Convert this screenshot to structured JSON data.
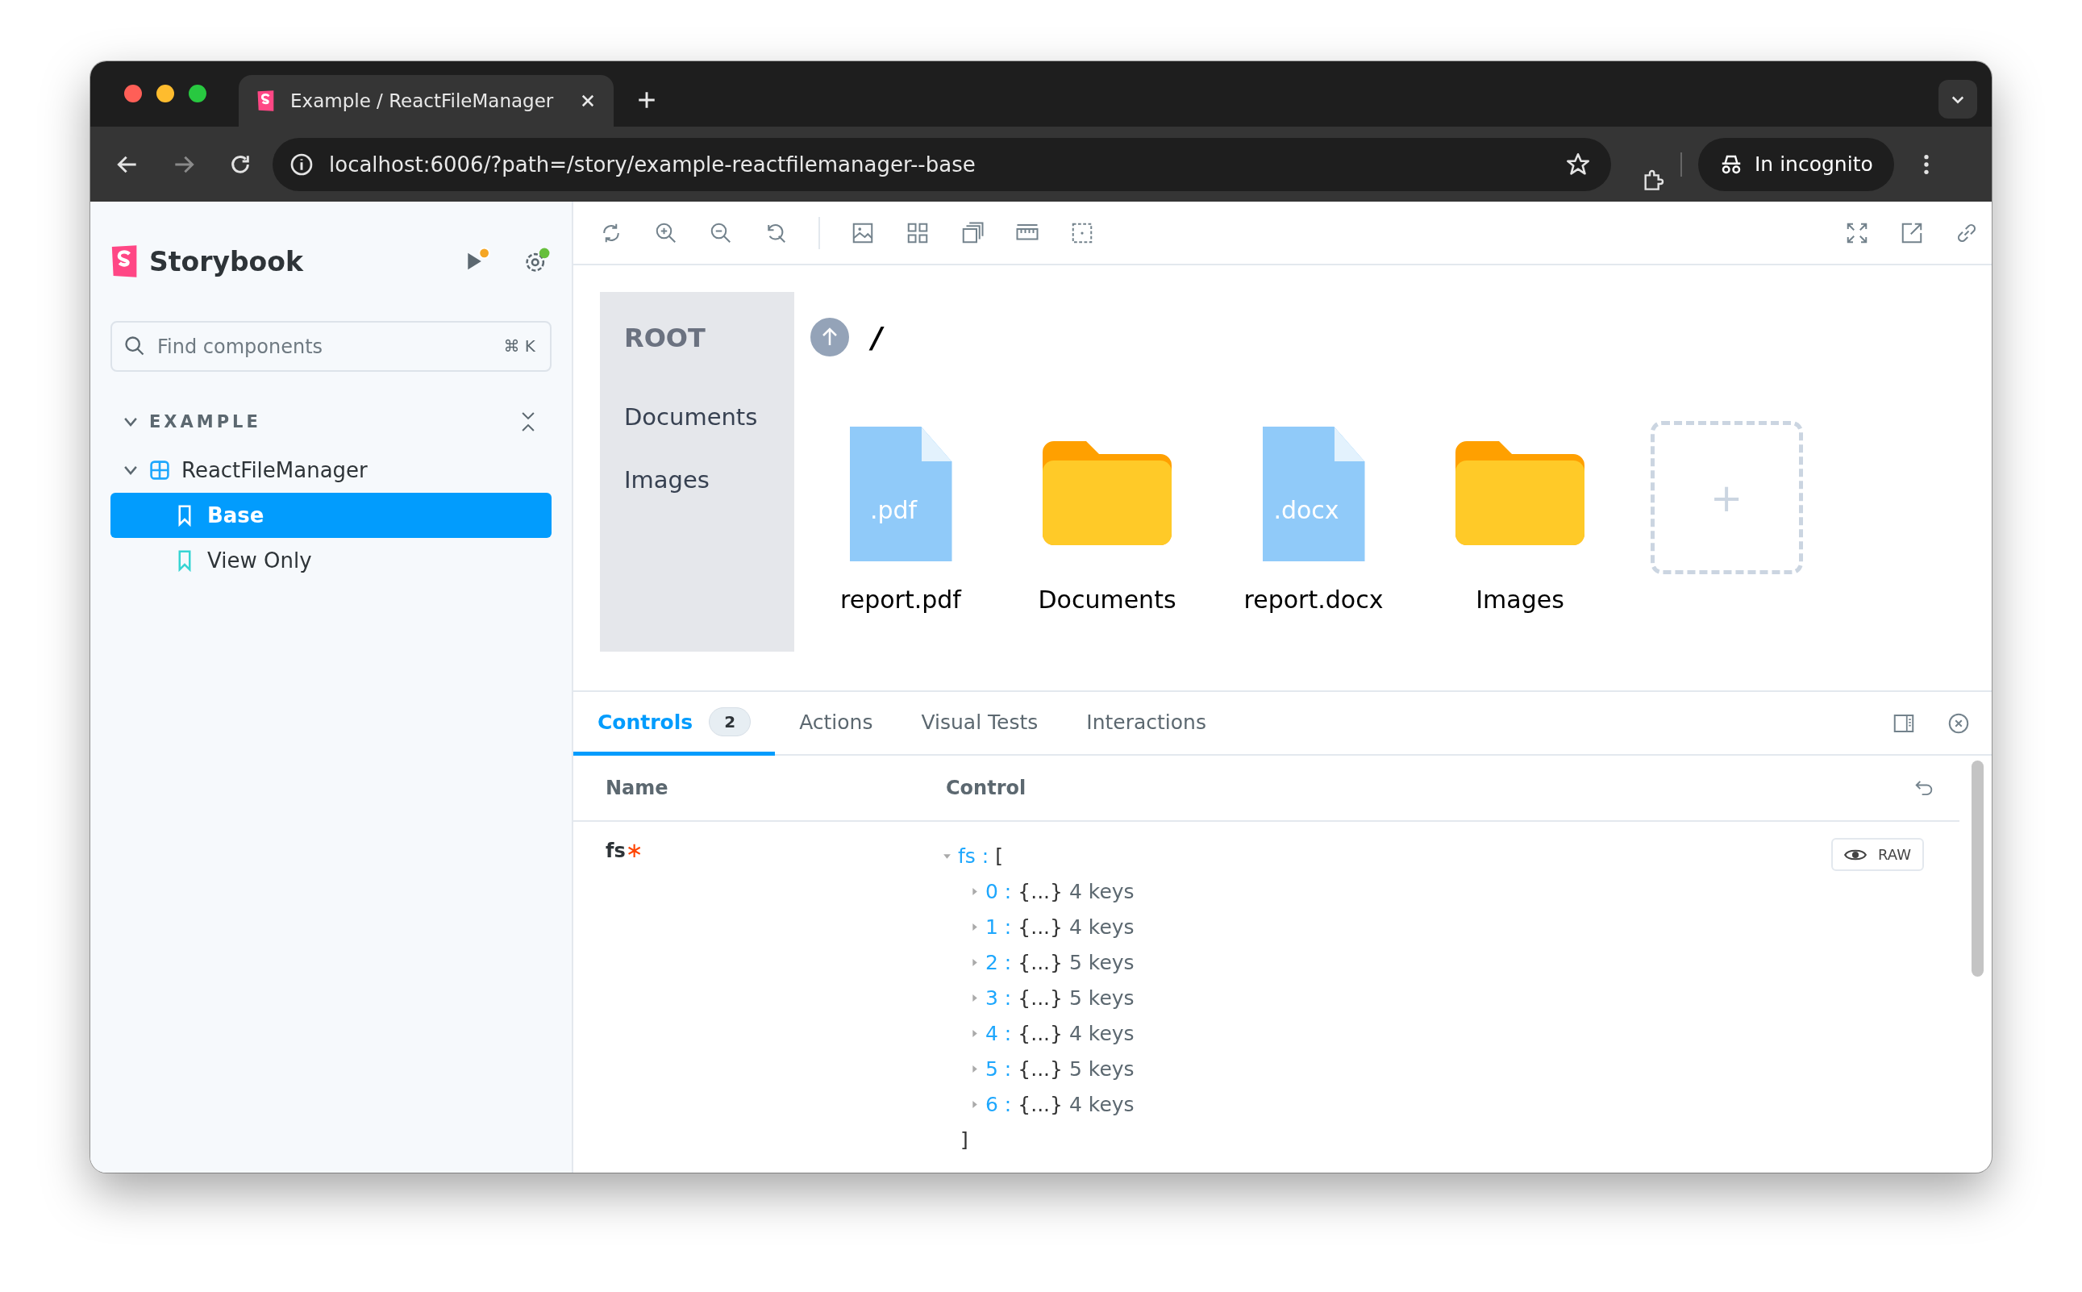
{
  "browser": {
    "tab_title": "Example / ReactFileManager",
    "url": "localhost:6006/?path=/story/example-reactfilemanager--base",
    "incognito_label": "In incognito"
  },
  "sidebar": {
    "brand": "Storybook",
    "search": {
      "placeholder": "Find components",
      "shortcut": "⌘ K"
    },
    "section": {
      "label": "EXAMPLE",
      "expanded": true
    },
    "tree": [
      {
        "label": "ReactFileManager",
        "expanded": true,
        "children": [
          {
            "label": "Base",
            "selected": true
          },
          {
            "label": "View Only",
            "selected": false
          }
        ]
      }
    ]
  },
  "file_manager": {
    "tree_title": "ROOT",
    "folders": [
      "Documents",
      "Images"
    ],
    "path": "/",
    "items": [
      {
        "kind": "file",
        "name": "report.pdf",
        "ext": ".pdf"
      },
      {
        "kind": "folder",
        "name": "Documents"
      },
      {
        "kind": "file",
        "name": "report.docx",
        "ext": ".docx"
      },
      {
        "kind": "folder",
        "name": "Images"
      },
      {
        "kind": "upload",
        "symbol": "+"
      }
    ]
  },
  "panel": {
    "tabs": [
      {
        "label": "Controls",
        "badge": "2",
        "selected": true
      },
      {
        "label": "Actions",
        "selected": false
      },
      {
        "label": "Visual Tests",
        "selected": false
      },
      {
        "label": "Interactions",
        "selected": false
      }
    ],
    "columns": [
      "Name",
      "Control"
    ],
    "arg": {
      "name": "fs",
      "required_mark": "∗",
      "root_key": "fs :",
      "open": "[",
      "close": "]",
      "raw_button": "RAW",
      "entries": [
        {
          "key": "0 :",
          "preview": "{...}",
          "count": "4 keys"
        },
        {
          "key": "1 :",
          "preview": "{...}",
          "count": "4 keys"
        },
        {
          "key": "2 :",
          "preview": "{...}",
          "count": "5 keys"
        },
        {
          "key": "3 :",
          "preview": "{...}",
          "count": "5 keys"
        },
        {
          "key": "4 :",
          "preview": "{...}",
          "count": "4 keys"
        },
        {
          "key": "5 :",
          "preview": "{...}",
          "count": "5 keys"
        },
        {
          "key": "6 :",
          "preview": "{...}",
          "count": "4 keys"
        }
      ]
    }
  }
}
